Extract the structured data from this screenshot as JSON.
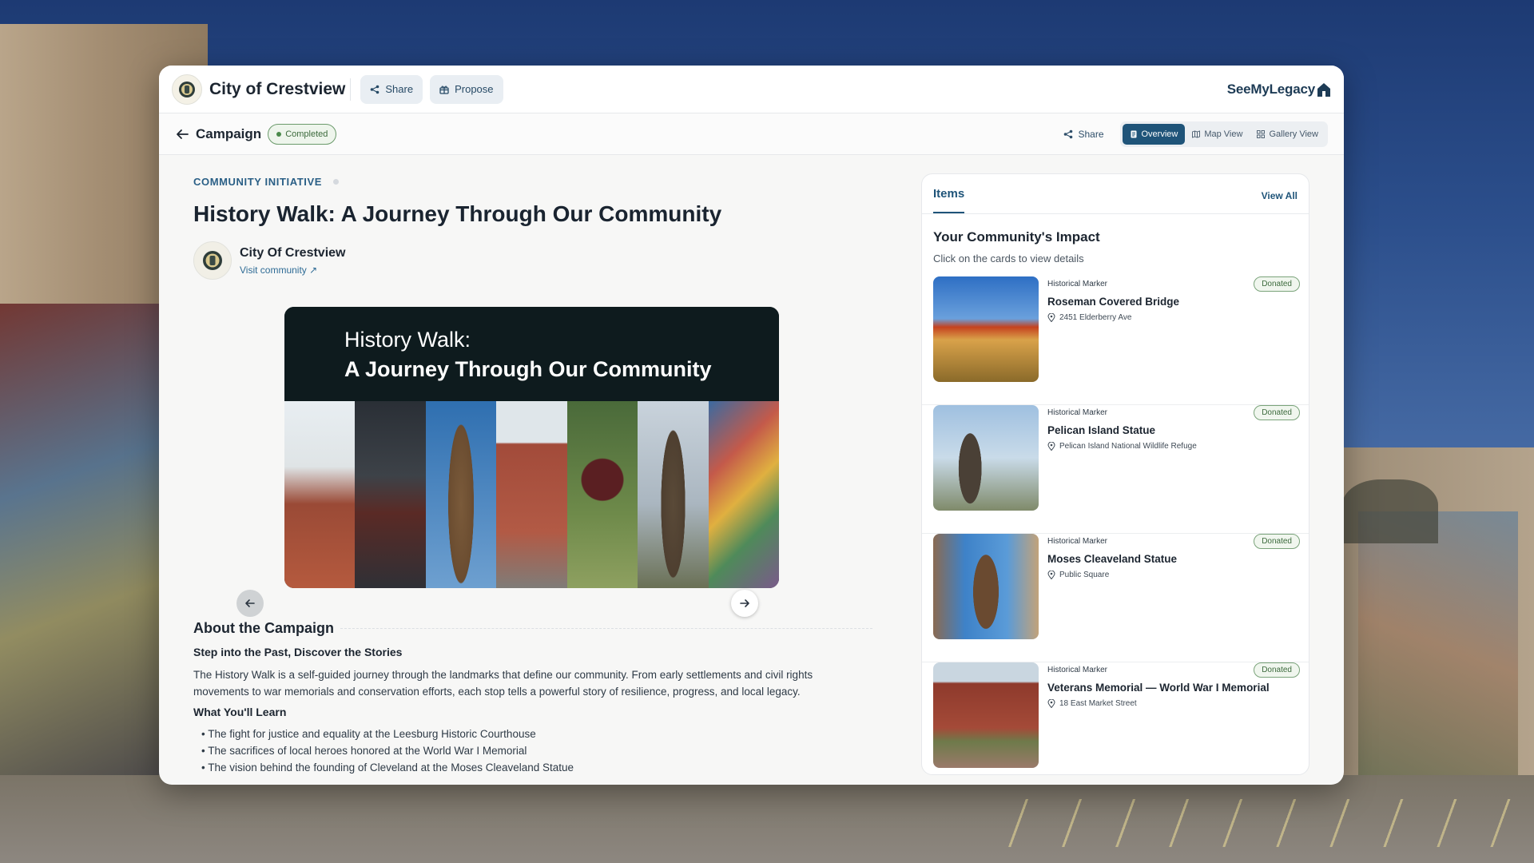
{
  "colors": {
    "accent": "#1f5479",
    "status_green": "#3c6a3c",
    "carousel_bg": "#0e1b1e"
  },
  "topbar": {
    "logo_icon": "city-seal-icon",
    "city_name": "City of Crestview",
    "share_label": "Share",
    "propose_label": "Propose",
    "brand_name": "SeeMyLegacy"
  },
  "subbar": {
    "title": "Campaign",
    "status": "Completed",
    "share_label": "Share",
    "tabs": [
      {
        "label": "Overview",
        "icon": "document-icon",
        "active": true
      },
      {
        "label": "Map View",
        "icon": "map-icon",
        "active": false
      },
      {
        "label": "Gallery View",
        "icon": "grid-icon",
        "active": false
      }
    ]
  },
  "main": {
    "eyebrow": "COMMUNITY INITIATIVE",
    "title": "History Walk: A Journey Through Our Community",
    "org": {
      "name": "City Of Crestview",
      "link": "Visit community ↗"
    },
    "carousel": {
      "line1": "History Walk:",
      "line2": "A Journey Through Our Community",
      "tiles": [
        "courthouse",
        "covered-bridge",
        "bronze-statue",
        "brick-memorial",
        "garden-sign",
        "fisherman-statue",
        "mural"
      ]
    },
    "about": {
      "title": "About the Campaign",
      "subtitle": "Step into the Past, Discover the Stories",
      "body": "The History Walk is a self-guided journey through the landmarks that define our community. From early settlements and civil rights movements to war memorials and conservation efforts, each stop tells a powerful story of resilience, progress, and local legacy.",
      "learn_title": "What You'll Learn",
      "learn_items": [
        "The fight for justice and equality at the Leesburg Historic Courthouse",
        "The sacrifices of local heroes honored at the World War I Memorial",
        "The vision behind the founding of Cleveland at the Moses Cleaveland Statue"
      ]
    }
  },
  "panel": {
    "tab": "Items",
    "view_all": "View All",
    "impact_title": "Your Community's Impact",
    "impact_sub": "Click on the cards to view details",
    "cards": [
      {
        "type": "Historical Marker",
        "badge": "Donated",
        "name": "Roseman Covered Bridge",
        "location": "2451 Elderberry Ave"
      },
      {
        "type": "Historical Marker",
        "badge": "Donated",
        "name": "Pelican Island Statue",
        "location": "Pelican Island National Wildlife Refuge"
      },
      {
        "type": "Historical Marker",
        "badge": "Donated",
        "name": "Moses Cleaveland Statue",
        "location": "Public Square"
      },
      {
        "type": "Historical Marker",
        "badge": "Donated",
        "name": "Veterans Memorial — World War I Memorial",
        "location": "18 East Market Street"
      }
    ]
  }
}
